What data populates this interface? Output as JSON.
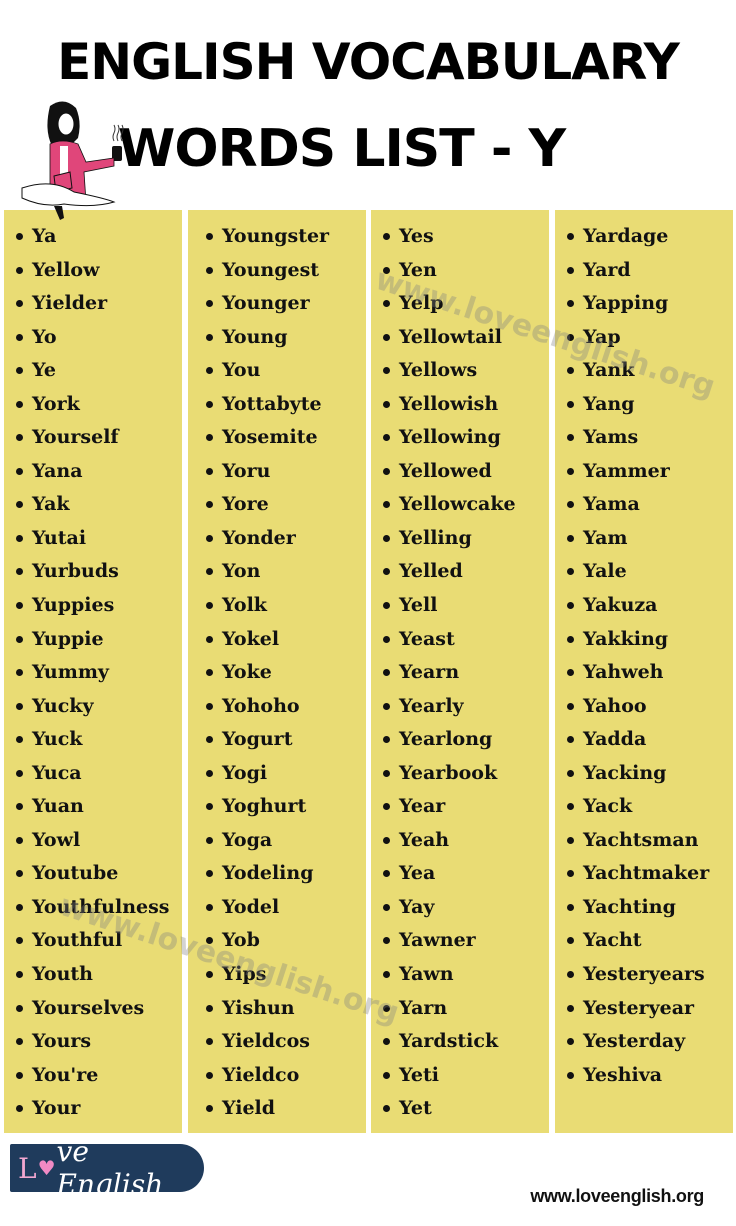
{
  "header": {
    "title_line1": "ENGLISH VOCABULARY",
    "title_line2": "WORDS LIST - Y",
    "illustration": "woman-reading-with-coffee-illustration"
  },
  "colors": {
    "panel_bg": "#e9dc74",
    "text": "#111111",
    "logo_bg": "#1f3b5c",
    "logo_accent": "#f08ac4",
    "illustration_jacket": "#e0467a"
  },
  "columns": [
    {
      "words": [
        "Ya",
        "Yellow",
        "Yielder",
        "Yo",
        "Ye",
        "York",
        "Yourself",
        "Yana",
        "Yak",
        "Yutai",
        "Yurbuds",
        "Yuppies",
        "Yuppie",
        "Yummy",
        "Yucky",
        "Yuck",
        "Yuca",
        "Yuan",
        "Yowl",
        "Youtube",
        "Youthfulness",
        "Youthful",
        "Youth",
        "Yourselves",
        "Yours",
        "You're",
        "Your"
      ]
    },
    {
      "words": [
        "Youngster",
        "Youngest",
        "Younger",
        "Young",
        "You",
        "Yottabyte",
        "Yosemite",
        "Yoru",
        "Yore",
        "Yonder",
        "Yon",
        "Yolk",
        "Yokel",
        "Yoke",
        "Yohoho",
        "Yogurt",
        "Yogi",
        "Yoghurt",
        "Yoga",
        "Yodeling",
        "Yodel",
        "Yob",
        "Yips",
        "Yishun",
        "Yieldcos",
        "Yieldco",
        "Yield"
      ]
    },
    {
      "words": [
        "Yes",
        "Yen",
        "Yelp",
        "Yellowtail",
        "Yellows",
        "Yellowish",
        "Yellowing",
        "Yellowed",
        "Yellowcake",
        "Yelling",
        "Yelled",
        "Yell",
        "Yeast",
        "Yearn",
        "Yearly",
        "Yearlong",
        "Yearbook",
        "Year",
        "Yeah",
        "Yea",
        "Yay",
        "Yawner",
        "Yawn",
        "Yarn",
        "Yardstick",
        "Yeti",
        "Yet"
      ]
    },
    {
      "words": [
        "Yardage",
        "Yard",
        "Yapping",
        "Yap",
        "Yank",
        "Yang",
        "Yams",
        "Yammer",
        "Yama",
        "Yam",
        "Yale",
        "Yakuza",
        "Yakking",
        "Yahweh",
        "Yahoo",
        "Yadda",
        "Yacking",
        "Yack",
        "Yachtsman",
        "Yachtmaker",
        "Yachting",
        "Yacht",
        "Yesteryears",
        "Yesteryear",
        "Yesterday",
        "Yeshiva"
      ]
    }
  ],
  "watermark": "www.loveenglish.org",
  "footer": {
    "logo_prefix": "L",
    "logo_heart": "♥",
    "logo_rest": "ve English",
    "url": "www.loveenglish.org"
  }
}
